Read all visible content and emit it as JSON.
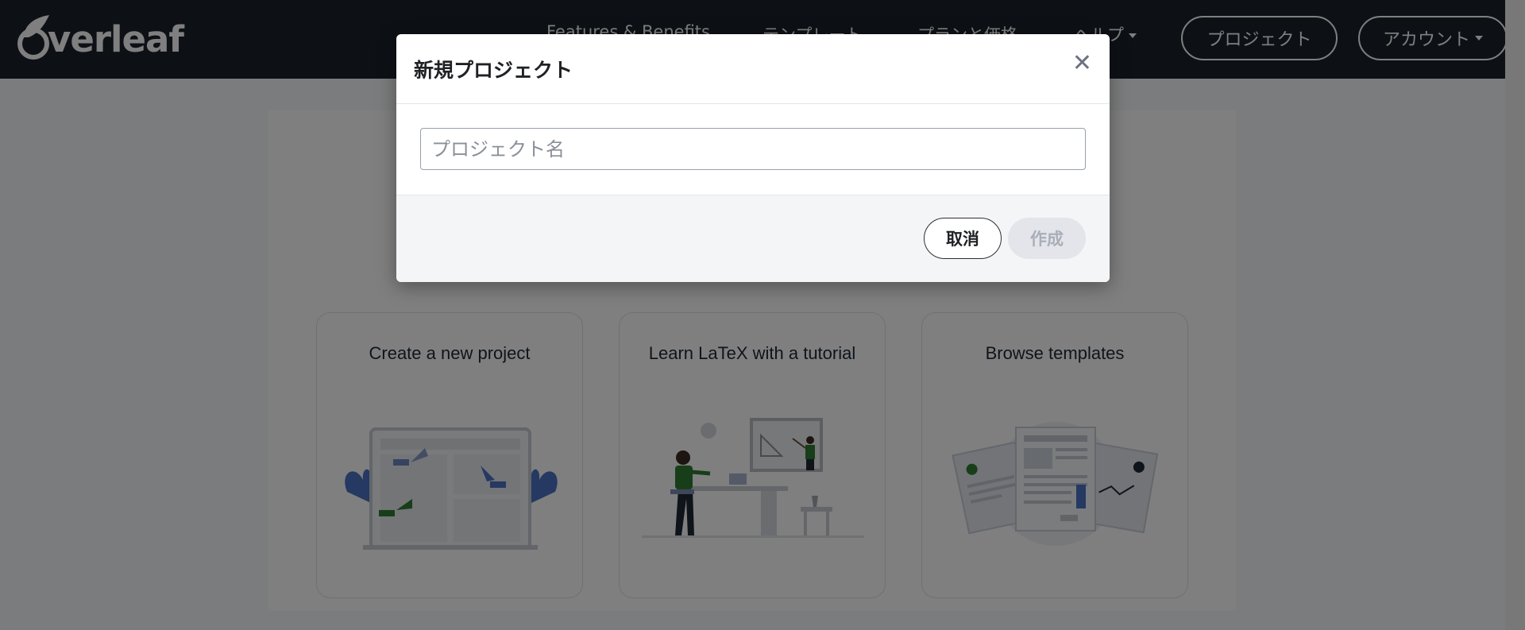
{
  "navbar": {
    "logo_text": "verleaf",
    "links": [
      {
        "label": "Features & Benefits"
      },
      {
        "label": "テンプレート"
      },
      {
        "label": "プランと価格"
      },
      {
        "label": "ヘルプ"
      }
    ],
    "projects_label": "プロジェクト",
    "account_label": "アカウント"
  },
  "cards": [
    {
      "title": "Create a new project",
      "icon": "laptop-cursors-illustration"
    },
    {
      "title": "Learn LaTeX with a tutorial",
      "icon": "teacher-student-illustration"
    },
    {
      "title": "Browse templates",
      "icon": "template-documents-illustration"
    }
  ],
  "modal": {
    "title": "新規プロジェクト",
    "close_icon": "close-icon",
    "input": {
      "placeholder": "プロジェクト名",
      "value": ""
    },
    "cancel_label": "取消",
    "create_label": "作成"
  },
  "colors": {
    "navbar_bg": "#1b222c",
    "overlay": "rgba(0,0,0,0.5)",
    "accent_green": "#2e7d32",
    "accent_blue": "#4a72c4"
  }
}
